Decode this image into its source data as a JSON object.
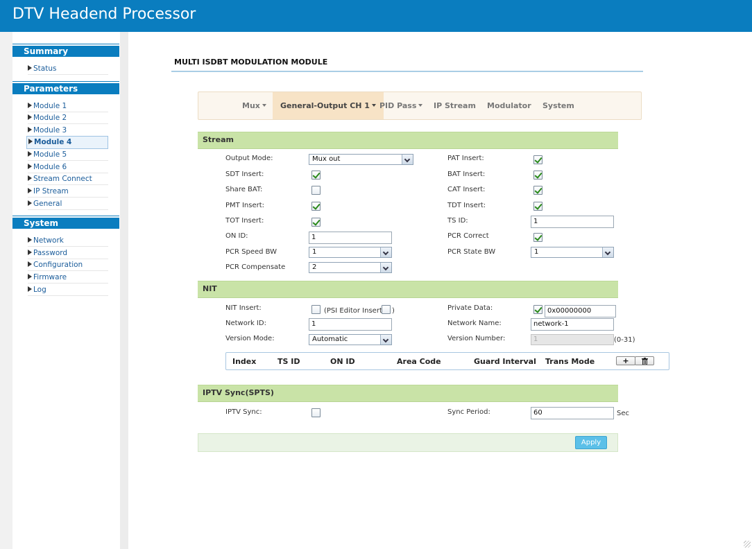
{
  "app": {
    "title": "DTV Headend Processor"
  },
  "sidebar": {
    "summary": {
      "title": "Summary",
      "items": [
        "Status"
      ]
    },
    "parameters": {
      "title": "Parameters",
      "items": [
        "Module 1",
        "Module 2",
        "Module 3",
        "Module 4",
        "Module 5",
        "Module 6",
        "Stream Connect",
        "IP Stream",
        "General"
      ],
      "active": "Module 4"
    },
    "system": {
      "title": "System",
      "items": [
        "Network",
        "Password",
        "Configuration",
        "Firmware",
        "Log"
      ]
    }
  },
  "page": {
    "title": "MULTI ISDBT MODULATION MODULE"
  },
  "tabs": [
    "Mux",
    "General-Output CH 1",
    "PID Pass",
    "IP Stream",
    "Modulator",
    "System"
  ],
  "stream": {
    "title": "Stream",
    "output_mode_label": "Output Mode:",
    "output_mode": "Mux out",
    "pat_insert_label": "PAT Insert:",
    "sdt_insert_label": "SDT Insert:",
    "bat_insert_label": "BAT Insert:",
    "share_bat_label": "Share BAT:",
    "cat_insert_label": "CAT Insert:",
    "pmt_insert_label": "PMT Insert:",
    "tdt_insert_label": "TDT Insert:",
    "tot_insert_label": "TOT Insert:",
    "ts_id_label": "TS ID:",
    "ts_id": "1",
    "on_id_label": "ON ID:",
    "on_id": "1",
    "pcr_correct_label": "PCR Correct",
    "pcr_speed_label": "PCR Speed BW",
    "pcr_speed": "1",
    "pcr_state_label": "PCR State BW",
    "pcr_state": "1",
    "pcr_comp_label": "PCR Compensate",
    "pcr_comp": "2",
    "checked": {
      "pat": true,
      "sdt": true,
      "bat": true,
      "share_bat": false,
      "cat": true,
      "pmt": true,
      "tdt": true,
      "tot": true,
      "pcr_correct": true
    }
  },
  "nit": {
    "title": "NIT",
    "nit_insert_label": "NIT Insert:",
    "psi_editor_label": "(PSI Editor Insert",
    "psi_close": ")",
    "private_data_label": "Private Data:",
    "private_data": "0x00000000",
    "network_id_label": "Network ID:",
    "network_id": "1",
    "network_name_label": "Network Name:",
    "network_name": "network-1",
    "version_mode_label": "Version Mode:",
    "version_mode": "Automatic",
    "version_number_label": "Version Number:",
    "version_number": "1",
    "version_range": "(0-31)",
    "checked": {
      "nit_insert": false,
      "psi_editor": false,
      "private_data": true
    },
    "table_headers": [
      "Index",
      "TS ID",
      "ON ID",
      "Area Code",
      "Guard Interval",
      "Trans Mode"
    ],
    "add_icon": "+",
    "delete_icon": "trash-icon"
  },
  "iptv": {
    "title": "IPTV Sync(SPTS)",
    "sync_label": "IPTV Sync:",
    "period_label": "Sync Period:",
    "period": "60",
    "period_unit": "Sec",
    "checked": {
      "sync": false
    }
  },
  "footer": {
    "apply": "Apply"
  }
}
